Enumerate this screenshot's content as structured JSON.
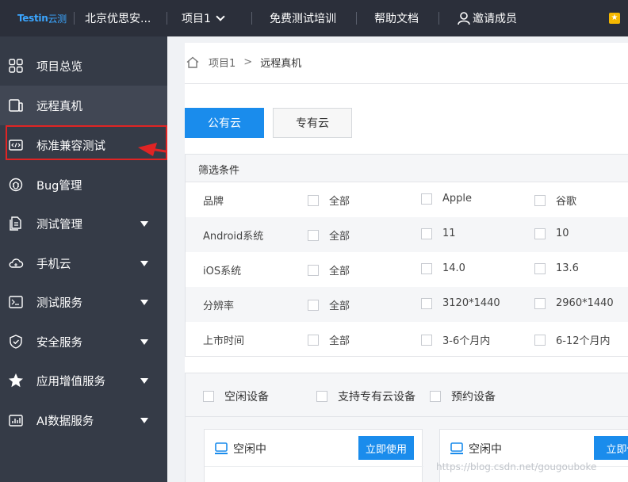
{
  "topbar": {
    "logo_brand": "Testin",
    "logo_suffix": "云测",
    "org": "北京优思安...",
    "project": "项目1",
    "nav": [
      "免费测试培训",
      "帮助文档",
      "邀请成员"
    ],
    "badge": "★"
  },
  "sidebar": {
    "items": [
      {
        "label": "项目总览",
        "icon": "grid-icon",
        "has_caret": false
      },
      {
        "label": "远程真机",
        "icon": "device-icon",
        "has_caret": false
      },
      {
        "label": "标准兼容测试",
        "icon": "code-monitor-icon",
        "has_caret": false
      },
      {
        "label": "Bug管理",
        "icon": "bug-icon",
        "has_caret": false
      },
      {
        "label": "测试管理",
        "icon": "document-icon",
        "has_caret": true
      },
      {
        "label": "手机云",
        "icon": "cloud-icon",
        "has_caret": true
      },
      {
        "label": "测试服务",
        "icon": "terminal-icon",
        "has_caret": true
      },
      {
        "label": "安全服务",
        "icon": "shield-icon",
        "has_caret": true
      },
      {
        "label": "应用增值服务",
        "icon": "star-icon",
        "has_caret": true
      },
      {
        "label": "AI数据服务",
        "icon": "chart-icon",
        "has_caret": true
      }
    ],
    "active_index": 1,
    "highlight_color": "#e02424",
    "collapse_glyph": "《"
  },
  "breadcrumb": {
    "items": [
      "项目1",
      "远程真机"
    ],
    "separator": ">"
  },
  "cloud_tabs": {
    "public": "公有云",
    "private": "专有云"
  },
  "filter": {
    "title": "筛选条件",
    "rows": [
      {
        "label": "品牌",
        "options": [
          "全部",
          "Apple",
          "谷歌"
        ]
      },
      {
        "label": "Android系统",
        "options": [
          "全部",
          "11",
          "10"
        ]
      },
      {
        "label": "iOS系统",
        "options": [
          "全部",
          "14.0",
          "13.6"
        ]
      },
      {
        "label": "分辨率",
        "options": [
          "全部",
          "3120*1440",
          "2960*1440"
        ]
      },
      {
        "label": "上市时间",
        "options": [
          "全部",
          "3-6个月内",
          "6-12个月内"
        ]
      }
    ]
  },
  "status_filters": [
    "空闲设备",
    "支持专有云设备",
    "预约设备"
  ],
  "devices": [
    {
      "status": "空闲中",
      "action": "立即使用"
    },
    {
      "status": "空闲中",
      "action": "立即使"
    }
  ],
  "watermark": "https://blog.csdn.net/gougouboke",
  "colors": {
    "topbar_bg": "#2b2f3a",
    "sidebar_bg": "#353b47",
    "primary": "#1a8cec"
  }
}
